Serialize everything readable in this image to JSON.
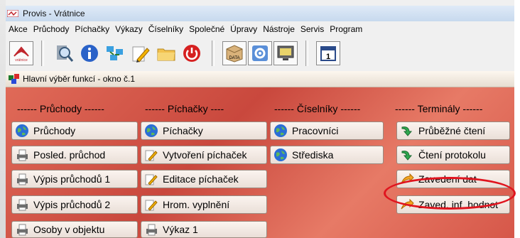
{
  "window": {
    "title": "Provis - Vrátnice"
  },
  "menu": [
    "Akce",
    "Průchody",
    "Píchačky",
    "Výkazy",
    "Číselníky",
    "Společné",
    "Úpravy",
    "Nástroje",
    "Servis",
    "Program"
  ],
  "toolbar": {
    "data_label": "DATA",
    "logo_text": "vrátnice",
    "calendar_label": "1"
  },
  "panel": {
    "title": "Hlavní výběr funkcí - okno č.1"
  },
  "columns": [
    {
      "header": "------ Průchody ------",
      "buttons": [
        "Průchody",
        "Posled. průchod",
        "Výpis průchodů 1",
        "Výpis průchodů 2",
        "Osoby v objektu"
      ]
    },
    {
      "header": "------ Píchačky ----",
      "buttons": [
        "Píchačky",
        "Vytvoření píchaček",
        "Editace píchaček",
        "Hrom. vyplnění",
        "Výkaz 1"
      ]
    },
    {
      "header": "------ Číselníky ------",
      "buttons": [
        "Pracovníci",
        "Střediska"
      ]
    },
    {
      "header": "------ Terminály ------",
      "buttons": [
        "Průběžné čtení",
        "Čtení protokolu",
        "Zavedení dat",
        "Zaved. inf. hodnot"
      ]
    }
  ],
  "colors": {
    "panel_gradient_start": "#e06a58",
    "panel_gradient_end": "#d65749",
    "highlight": "#e0141e"
  }
}
